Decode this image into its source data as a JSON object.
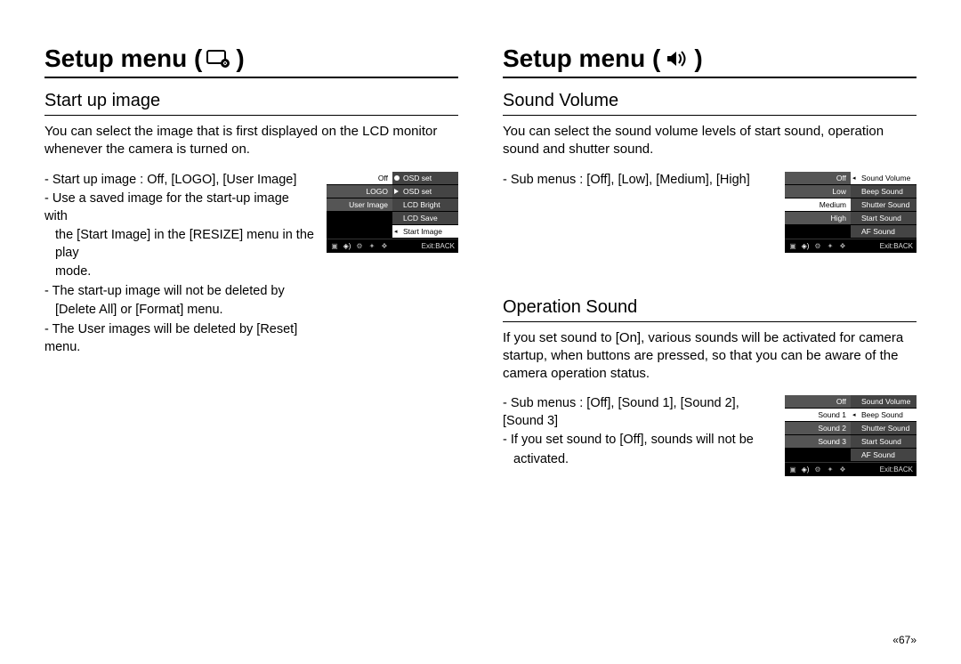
{
  "left": {
    "header": {
      "prefix": "Setup menu (",
      "suffix": ")",
      "icon_name": "display-icon"
    },
    "section": {
      "title": "Start up image",
      "body": "You can select the image that is first displayed on the LCD monitor whenever the camera is turned on.",
      "bullets": {
        "l1": "- Start up image : Off, [LOGO], [User Image]",
        "l2": "- Use a saved image for the start-up image with",
        "l2b": "the [Start Image] in the [RESIZE] menu in the play",
        "l2c": "mode.",
        "l3": "- The start-up image will not be deleted by",
        "l3b": "[Delete All] or [Format] menu.",
        "l4": "- The User images will be deleted by [Reset] menu."
      },
      "lcd": {
        "left": [
          "Off",
          "LOGO",
          "User Image",
          "",
          ""
        ],
        "left_sel": 0,
        "right": [
          "OSD set",
          "OSD set",
          "LCD Bright",
          "LCD Save",
          "Start Image"
        ],
        "right_sel": 4,
        "footer": "Exit:BACK"
      }
    }
  },
  "right": {
    "header": {
      "prefix": "Setup menu (",
      "suffix": ")",
      "icon_name": "speaker-icon"
    },
    "section1": {
      "title": "Sound Volume",
      "body": "You can select the sound volume levels of start sound, operation sound and shutter sound.",
      "bullets": {
        "l1": "- Sub menus : [Off], [Low], [Medium], [High]"
      },
      "lcd": {
        "left": [
          "Off",
          "Low",
          "Medium",
          "High",
          ""
        ],
        "left_sel": 2,
        "right": [
          "Sound Volume",
          "Beep Sound",
          "Shutter Sound",
          "Start Sound",
          "AF Sound"
        ],
        "right_sel": 0,
        "footer": "Exit:BACK"
      }
    },
    "section2": {
      "title": "Operation Sound",
      "body": "If you set sound to [On], various sounds will be activated for camera startup, when buttons are pressed, so that you can be aware of the camera operation status.",
      "bullets": {
        "l1": "- Sub menus : [Off], [Sound 1], [Sound 2], [Sound 3]",
        "l2": "- If you set sound to [Off], sounds will not be",
        "l2b": "activated."
      },
      "lcd": {
        "left": [
          "Off",
          "Sound 1",
          "Sound 2",
          "Sound 3",
          ""
        ],
        "left_sel": 1,
        "right": [
          "Sound Volume",
          "Beep Sound",
          "Shutter Sound",
          "Start Sound",
          "AF Sound"
        ],
        "right_sel": 1,
        "footer": "Exit:BACK"
      }
    }
  },
  "page": "«67»"
}
